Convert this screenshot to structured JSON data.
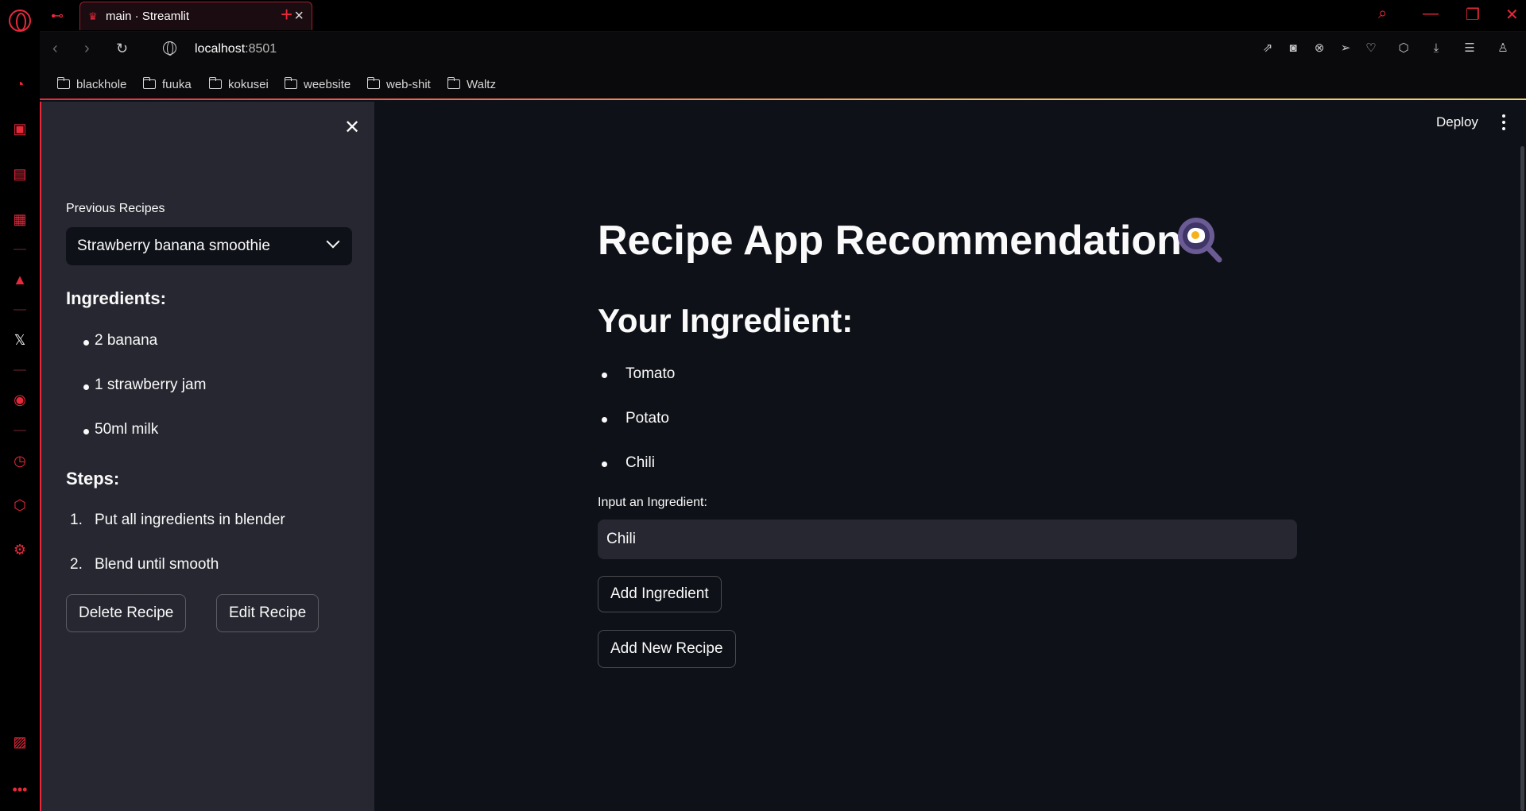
{
  "browser": {
    "tab_title": "main · Streamlit",
    "url_host": "localhost",
    "url_port": ":8501",
    "bookmarks": [
      "blackhole",
      "fuuka",
      "kokusei",
      "weebsite",
      "web-shit",
      "Waltz"
    ]
  },
  "app": {
    "sidebar": {
      "select_label": "Previous Recipes",
      "selected_recipe": "Strawberry banana smoothie",
      "ingredients_heading": "Ingredients:",
      "ingredients": [
        "2 banana",
        "1 strawberry jam",
        "50ml milk"
      ],
      "steps_heading": "Steps:",
      "steps": [
        "Put all ingredients in blender",
        "Blend until smooth"
      ],
      "step_numbers": [
        "1.",
        "2."
      ],
      "delete_button": "Delete Recipe",
      "edit_button": "Edit Recipe"
    },
    "header": {
      "deploy_label": "Deploy"
    },
    "main": {
      "title": "Recipe App Recommendation",
      "subtitle": "Your Ingredient:",
      "ingredients": [
        "Tomato",
        "Potato",
        "Chili"
      ],
      "input_label": "Input an Ingredient:",
      "input_value": "Chili",
      "add_ingredient_button": "Add Ingredient",
      "add_recipe_button": "Add New Recipe"
    }
  },
  "colors": {
    "accent": "#e8293b",
    "app_bg": "#0e1117",
    "sidebar_bg": "#262730"
  }
}
